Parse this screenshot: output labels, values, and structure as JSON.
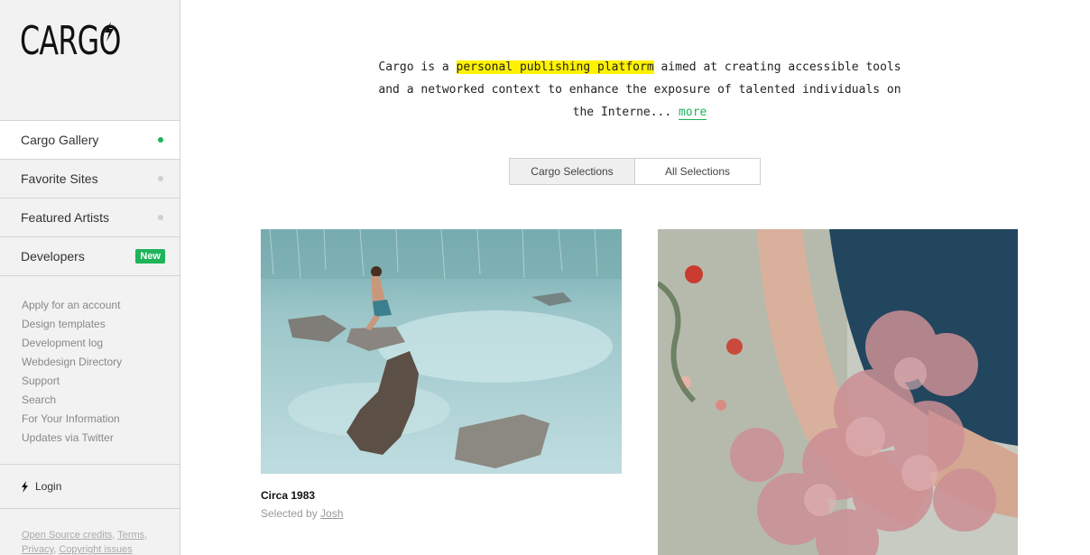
{
  "logo": {
    "text": "CARGO"
  },
  "nav": {
    "items": [
      {
        "label": "Cargo Gallery"
      },
      {
        "label": "Favorite Sites"
      },
      {
        "label": "Featured Artists"
      },
      {
        "label": "Developers",
        "badge": "New"
      }
    ]
  },
  "links": [
    "Apply for an account",
    "Design templates",
    "Development log",
    "Webdesign Directory",
    "Support",
    "Search",
    "For Your Information",
    "Updates via Twitter"
  ],
  "login": {
    "label": "Login"
  },
  "footer": {
    "credits": "Open Source credits",
    "terms": "Terms",
    "privacy": "Privacy",
    "copyright": "Copyright issues"
  },
  "intro": {
    "prefix": "Cargo is a ",
    "highlight": "personal publishing platform",
    "suffix": " aimed at creating accessible tools and a networked context to enhance the exposure of talented individuals on the Interne...",
    "more": "more"
  },
  "toggle": {
    "left": "Cargo Selections",
    "right": "All Selections"
  },
  "gallery": {
    "item1": {
      "title": "Circa 1983",
      "selected_by_prefix": "Selected by ",
      "selected_by": "Josh"
    }
  },
  "colors": {
    "accent": "#1fb35a",
    "highlight": "#fff200",
    "sidebar": "#f2f2f2"
  }
}
